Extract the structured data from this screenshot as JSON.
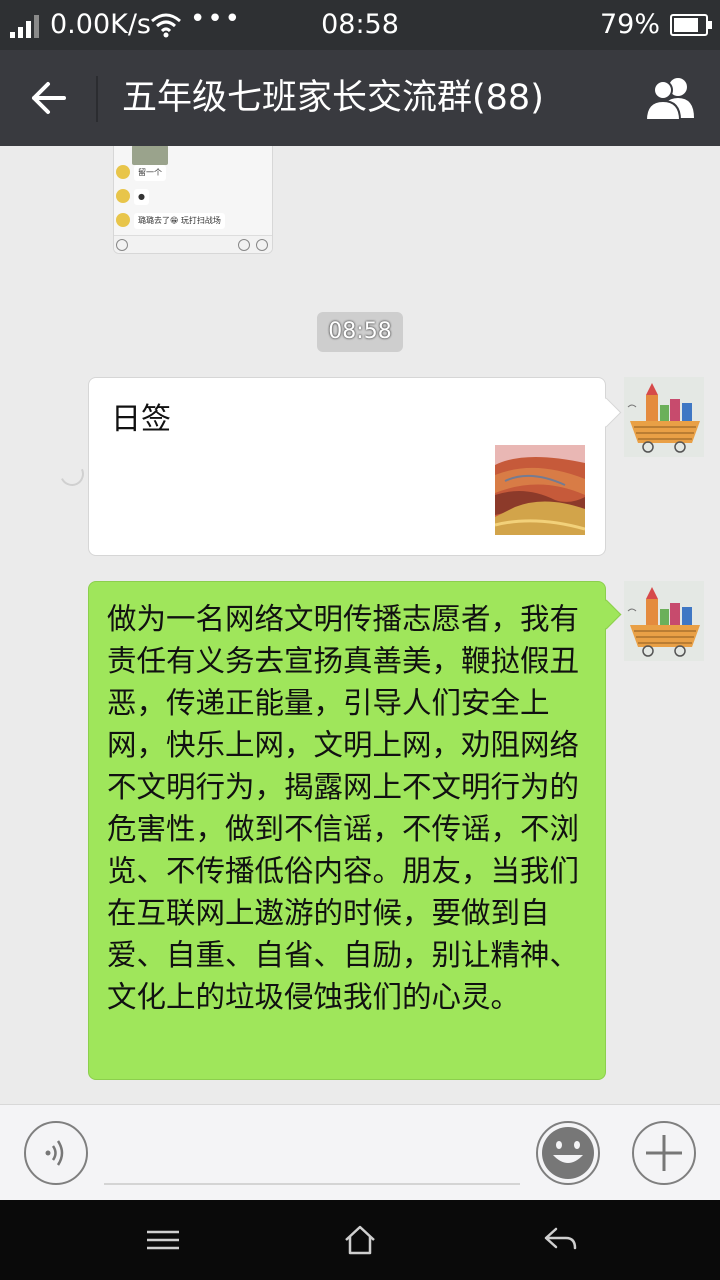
{
  "status_bar": {
    "net_speed": "0.00K/s",
    "dots": "•••",
    "time": "08:58",
    "battery_pct": "79%",
    "battery_level": 0.79
  },
  "header": {
    "title": "五年级七班家长交流群(88)"
  },
  "preview_card": {
    "rows": [
      "留一个",
      "",
      "璐璐去了😁 玩打扫战场"
    ]
  },
  "chat": {
    "timestamp": "08:58",
    "share_card": {
      "title": "日签"
    },
    "text_message": "做为一名网络文明传播志愿者，我有责任有义务去宣扬真善美，鞭挞假丑恶，传递正能量，引导人们安全上网，快乐上网，文明上网，劝阻网络不文明行为，揭露网上不文明行为的危害性，做到不信谣，不传谣，不浏览、不传播低俗内容。朋友，当我们在互联网上遨游的时候，要做到自爱、自重、自省、自励，别让精神、文化上的垃圾侵蚀我们的心灵。"
  },
  "icons": {
    "back": "arrow-left-icon",
    "members": "group-members-icon",
    "voice": "voice-icon",
    "emoji": "smiley-icon",
    "more": "plus-icon",
    "nav_menu": "menu-icon",
    "nav_home": "home-icon",
    "nav_back": "back-icon"
  },
  "colors": {
    "status_bar": "#2e3033",
    "title_bar": "#393a3f",
    "chat_bg": "#ebebeb",
    "bubble_green": "#9fe65b"
  }
}
